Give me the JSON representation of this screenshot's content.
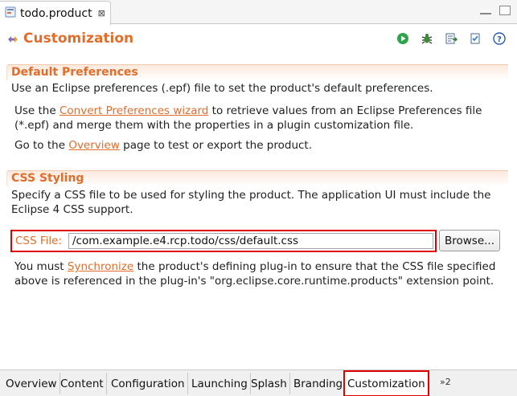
{
  "tab": {
    "label": "todo.product",
    "close_glyph": "⊠"
  },
  "header": {
    "title": "Customization"
  },
  "toolbar": {
    "icons": [
      "run-icon",
      "debug-icon",
      "export-icon",
      "validate-icon",
      "help-icon"
    ]
  },
  "default_prefs": {
    "title": "Default Preferences",
    "line1": "Use an Eclipse preferences (.epf) file to set the product's default preferences.",
    "p2_pre": "Use the ",
    "p2_link": "Convert Preferences wizard",
    "p2_post": " to retrieve values from an Eclipse Preferences file (*.epf) and merge them with the properties in a plugin customization file.",
    "p3_pre": "Go to the ",
    "p3_link": "Overview",
    "p3_post": " page to test or export the product."
  },
  "css_styling": {
    "title": "CSS Styling",
    "desc": "Specify a CSS file to be used for styling the product. The application UI must include the Eclipse 4 CSS support.",
    "file_label": "CSS File:",
    "file_value": "/com.example.e4.rcp.todo/css/default.css",
    "browse_label": "Browse...",
    "note_pre": "You must ",
    "note_link": "Synchronize",
    "note_post": " the product's defining plug-in to ensure that the CSS file specified above is referenced in the plug-in's \"org.eclipse.core.runtime.products\" extension point."
  },
  "bottom_tabs": [
    {
      "label": "Overview"
    },
    {
      "label": "Content"
    },
    {
      "label": "Configuration"
    },
    {
      "label": "Launching"
    },
    {
      "label": "Splash"
    },
    {
      "label": "Branding"
    },
    {
      "label": "Customization",
      "active": true
    }
  ],
  "more_tabs": "»2",
  "colors": {
    "accent": "#e06d2a",
    "highlight": "#e00000"
  }
}
